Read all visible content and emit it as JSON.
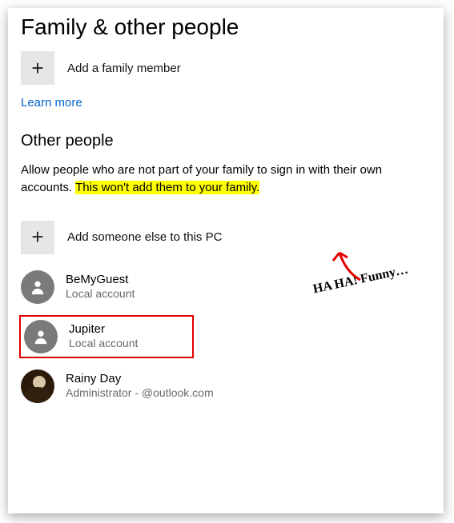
{
  "title": "Family & other people",
  "addFamily": {
    "label": "Add a family member"
  },
  "learnMore": "Learn more",
  "otherPeople": {
    "title": "Other people",
    "descPlain": "Allow people who are not part of your family to sign in with their own accounts. ",
    "descHighlighted": "This won't add them to your family.",
    "addOther": {
      "label": "Add someone else to this PC"
    },
    "users": [
      {
        "name": "BeMyGuest",
        "sub": "Local account"
      },
      {
        "name": "Jupiter",
        "sub": "Local account"
      },
      {
        "name": "Rainy Day",
        "sub": "Administrator -           @outlook.com"
      }
    ]
  },
  "annotation": "HA HA! Funny…",
  "colors": {
    "link": "#0066cc",
    "highlight": "#ffff00",
    "selection": "#e30000"
  }
}
